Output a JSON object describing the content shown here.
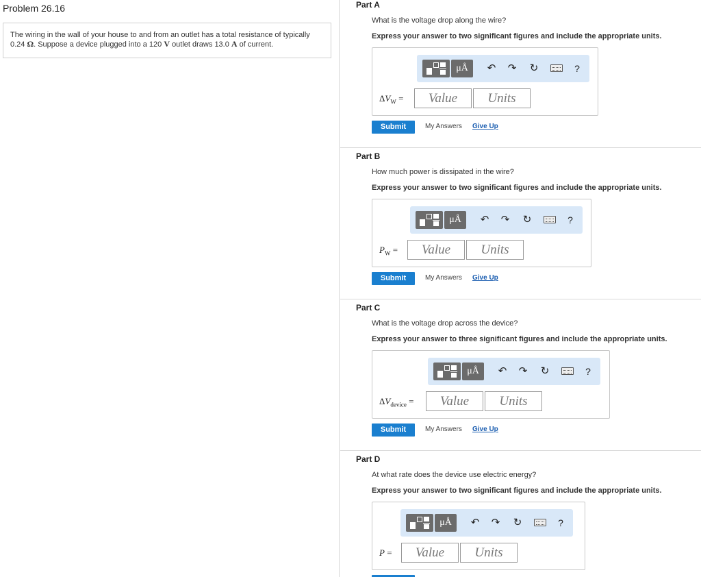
{
  "problem": {
    "title": "Problem 26.16",
    "text_line1": "The wiring in the wall of your house to and from an outlet has a total resistance of typically",
    "resistance_value": "0.24",
    "resistance_unit": "Ω",
    "text_line2a": ". Suppose a device plugged into a",
    "voltage_value": "120",
    "voltage_unit": "V",
    "text_line2b": "outlet draws",
    "current_value": "13.0",
    "current_unit": "A",
    "text_line2c": "of current."
  },
  "toolbar": {
    "units_label": "μÅ",
    "undo_glyph": "↶",
    "redo_glyph": "↷",
    "reset_glyph": "↻",
    "help_label": "?",
    "icons": [
      "templates-icon",
      "units-icon",
      "undo-icon",
      "redo-icon",
      "reset-icon",
      "keyboard-icon",
      "help-icon"
    ]
  },
  "inputs": {
    "value_placeholder": "Value",
    "units_placeholder": "Units"
  },
  "actions": {
    "submit": "Submit",
    "my_answers": "My Answers",
    "give_up": "Give Up"
  },
  "parts": [
    {
      "title": "Part A",
      "question": "What is the voltage drop along the wire?",
      "instruction": "Express your answer to two significant figures and include the appropriate units.",
      "var_prefix": "Δ",
      "var_symbol": "V",
      "var_sub": "W",
      "var_eq": " ="
    },
    {
      "title": "Part B",
      "question": "How much power is dissipated in the wire?",
      "instruction": "Express your answer to two significant figures and include the appropriate units.",
      "var_prefix": "",
      "var_symbol": "P",
      "var_sub": "W",
      "var_eq": " ="
    },
    {
      "title": "Part C",
      "question": "What is the voltage drop across the device?",
      "instruction": "Express your answer to three significant figures and include the appropriate units.",
      "var_prefix": "Δ",
      "var_symbol": "V",
      "var_sub": "device",
      "var_eq": " ="
    },
    {
      "title": "Part D",
      "question": "At what rate does the device use electric energy?",
      "instruction": "Express your answer to two significant figures and include the appropriate units.",
      "var_prefix": "",
      "var_symbol": "P",
      "var_sub": "",
      "var_eq": " ="
    }
  ],
  "colors": {
    "submit_bg": "#1a7fcf",
    "toolbar_bg": "#d9e8f8",
    "link": "#1a5db0"
  }
}
